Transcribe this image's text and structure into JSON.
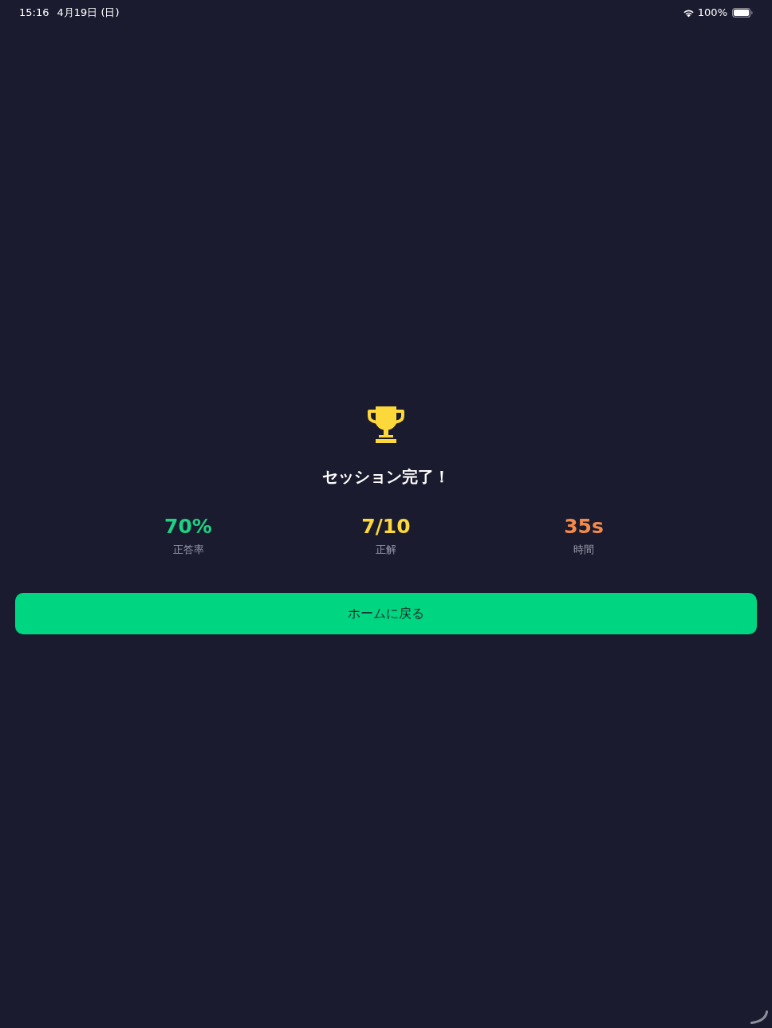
{
  "status_bar": {
    "time": "15:16",
    "date": "4月19日 (日)",
    "battery_text": "100%"
  },
  "result": {
    "title": "セッション完了！",
    "stats": [
      {
        "value": "70%",
        "label": "正答率",
        "color": "#1ed283"
      },
      {
        "value": "7/10",
        "label": "正解",
        "color": "#fdd83a"
      },
      {
        "value": "35s",
        "label": "時間",
        "color": "#f28b4c"
      }
    ]
  },
  "home_button": {
    "label": "ホームに戻る"
  }
}
